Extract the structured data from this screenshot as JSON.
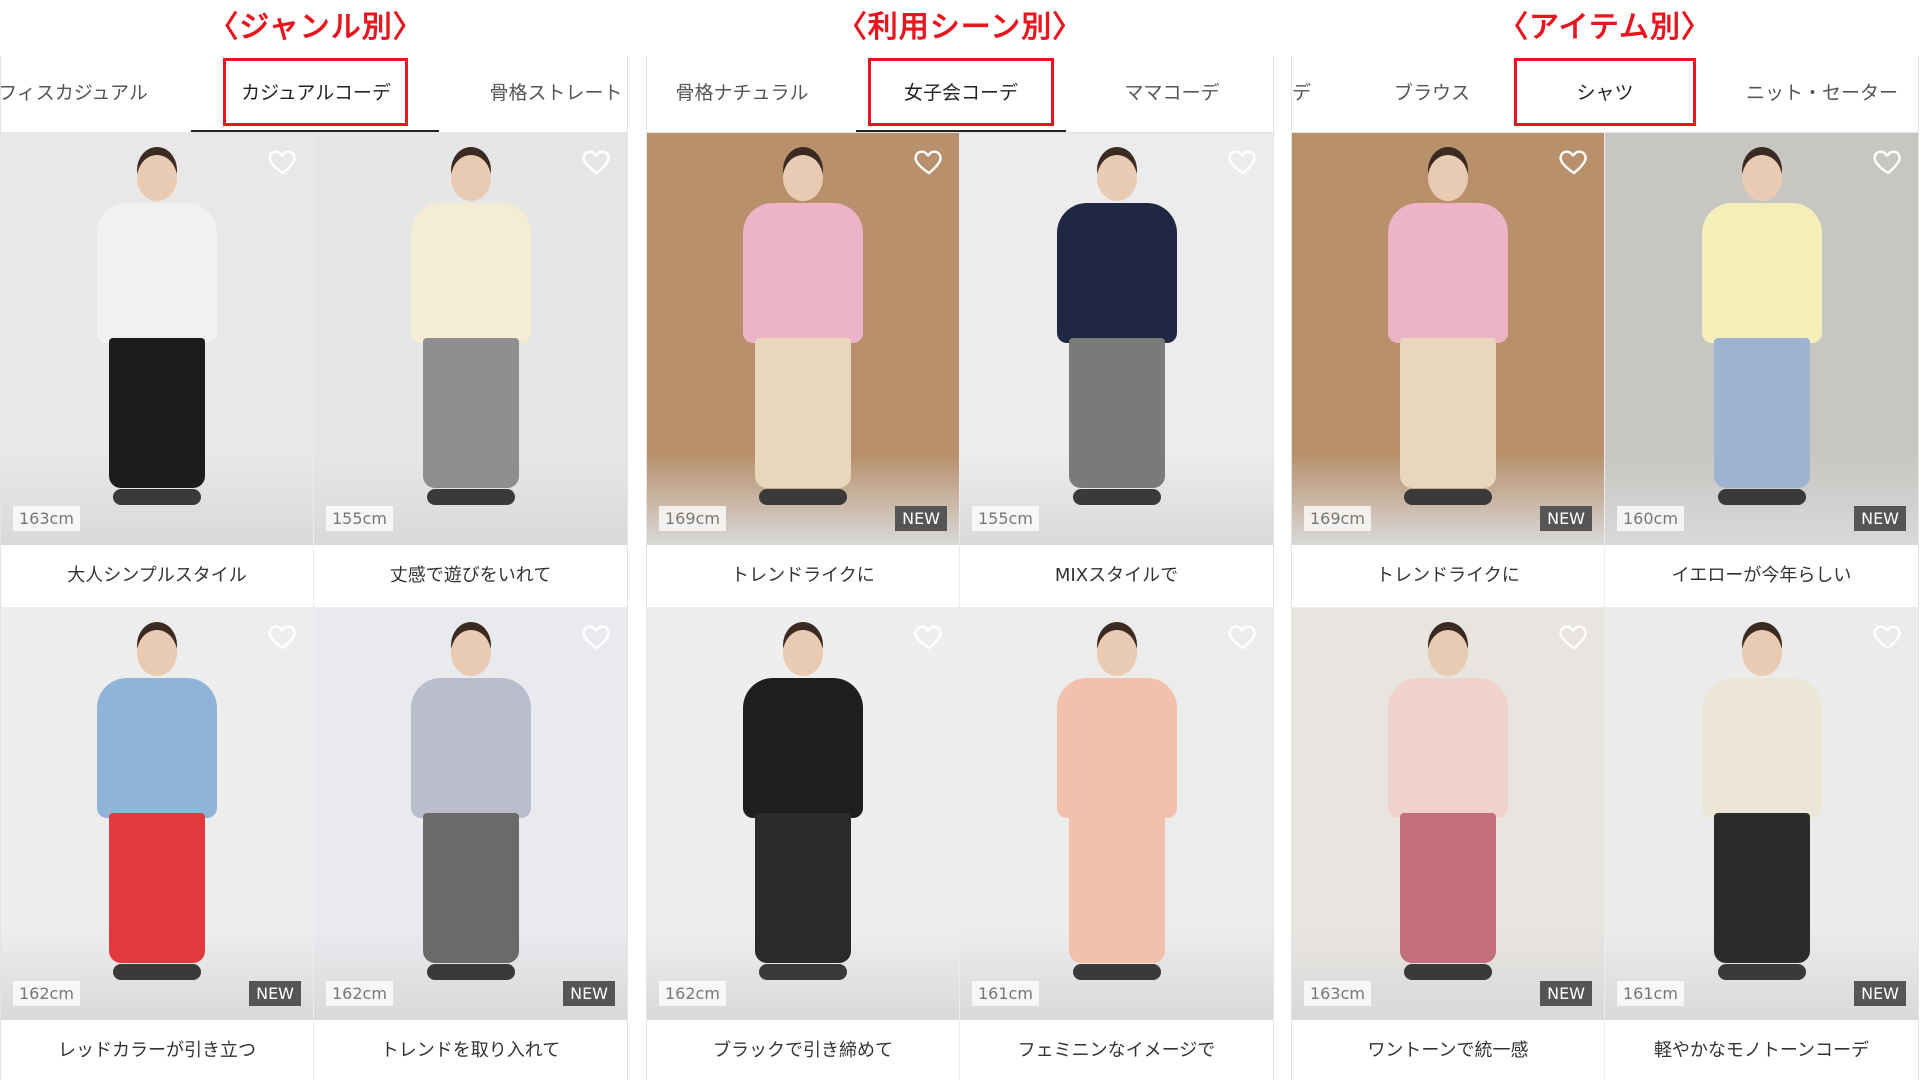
{
  "panels": [
    {
      "section_title": "〈ジャンル別〉",
      "tabs": [
        "フィスカジュアル",
        "カジュアルコーデ",
        "骨格ストレート"
      ],
      "active_tab": 1,
      "items": [
        {
          "caption": "大人シンプルスタイル",
          "height": "163cm",
          "is_new": false,
          "bg": "#e9e8e6",
          "top": "#f1f1f1",
          "bottom": "#1c1c1c"
        },
        {
          "caption": "丈感で遊びをいれて",
          "height": "155cm",
          "is_new": false,
          "bg": "#e6e6e6",
          "top": "#f4ecd4",
          "bottom": "#8e8e8e"
        },
        {
          "caption": "レッドカラーが引き立つ",
          "height": "162cm",
          "is_new": true,
          "new_label": "NEW",
          "bg": "#ededed",
          "top": "#8fb4d8",
          "bottom": "#e23a3c"
        },
        {
          "caption": "トレンドを取り入れて",
          "height": "162cm",
          "is_new": true,
          "new_label": "NEW",
          "bg": "#e9eaee",
          "top": "#bcbdcc",
          "bottom": "#6a6a6a"
        }
      ]
    },
    {
      "section_title": "〈利用シーン別〉",
      "tabs": [
        "骨格ナチュラル",
        "女子会コーデ",
        "ママコーデ"
      ],
      "active_tab": 1,
      "items": [
        {
          "caption": "トレンドライクに",
          "height": "169cm",
          "is_new": true,
          "new_label": "NEW",
          "bg": "#b8906c",
          "top": "#ecb4c6",
          "bottom": "#e8d7bd"
        },
        {
          "caption": "MIXスタイルで",
          "height": "155cm",
          "is_new": false,
          "bg": "#ececec",
          "top": "#1f2742",
          "bottom": "#7a7a7a"
        },
        {
          "caption": "ブラックで引き締めて",
          "height": "162cm",
          "is_new": false,
          "bg": "#eeeeee",
          "top": "#1e1e1e",
          "bottom": "#2a2a2a"
        },
        {
          "caption": "フェミニンなイメージで",
          "height": "161cm",
          "is_new": false,
          "bg": "#ececec",
          "top": "#f2c0ad",
          "bottom": "#f2c0ad"
        }
      ]
    },
    {
      "section_title": "〈アイテム別〉",
      "tabs": [
        "デ",
        "ブラウス",
        "シャツ",
        "ニット・セーター"
      ],
      "active_tab": 2,
      "items": [
        {
          "caption": "トレンドライクに",
          "height": "169cm",
          "is_new": true,
          "new_label": "NEW",
          "bg": "#b8906c",
          "top": "#ecb4c6",
          "bottom": "#e8d7bd"
        },
        {
          "caption": "イエローが今年らしい",
          "height": "160cm",
          "is_new": true,
          "new_label": "NEW",
          "bg": "#c8c6c2",
          "top": "#f4efb8",
          "bottom": "#9cb3d2"
        },
        {
          "caption": "ワントーンで統一感",
          "height": "163cm",
          "is_new": true,
          "new_label": "NEW",
          "bg": "#e8e4e0",
          "top": "#f0d2cc",
          "bottom": "#c46e7c"
        },
        {
          "caption": "軽やかなモノトーンコーデ",
          "height": "161cm",
          "is_new": true,
          "new_label": "NEW",
          "bg": "#ebebeb",
          "top": "#ece6d6",
          "bottom": "#2b2b2b"
        }
      ]
    }
  ],
  "colors": {
    "accent": "#e8141e",
    "heart": "#ffffff",
    "new_badge": "#555555"
  },
  "icons": {
    "favorite": "heart-icon"
  }
}
